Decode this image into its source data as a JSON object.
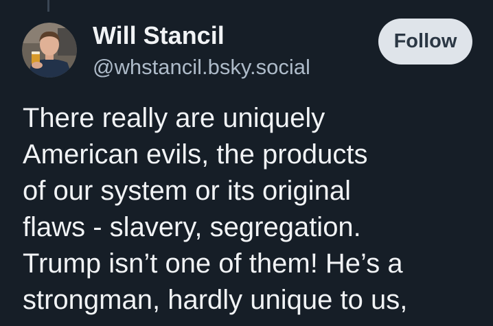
{
  "author": {
    "display_name": "Will Stancil",
    "handle": "@whstancil.bsky.social",
    "avatar_icon": "profile-photo"
  },
  "actions": {
    "follow_label": "Follow"
  },
  "post": {
    "lines": [
      "There really are uniquely",
      "American evils, the products",
      "of our system or its original",
      "flaws - slavery, segregation.",
      "Trump isn’t one of them! He’s a",
      "strongman, hardly unique to us,"
    ]
  },
  "colors": {
    "background": "#161e27",
    "text_primary": "#f1f3f5",
    "text_secondary": "#aebbc9",
    "follow_button_bg": "#dfe4ea",
    "follow_button_text": "#2b3744"
  }
}
